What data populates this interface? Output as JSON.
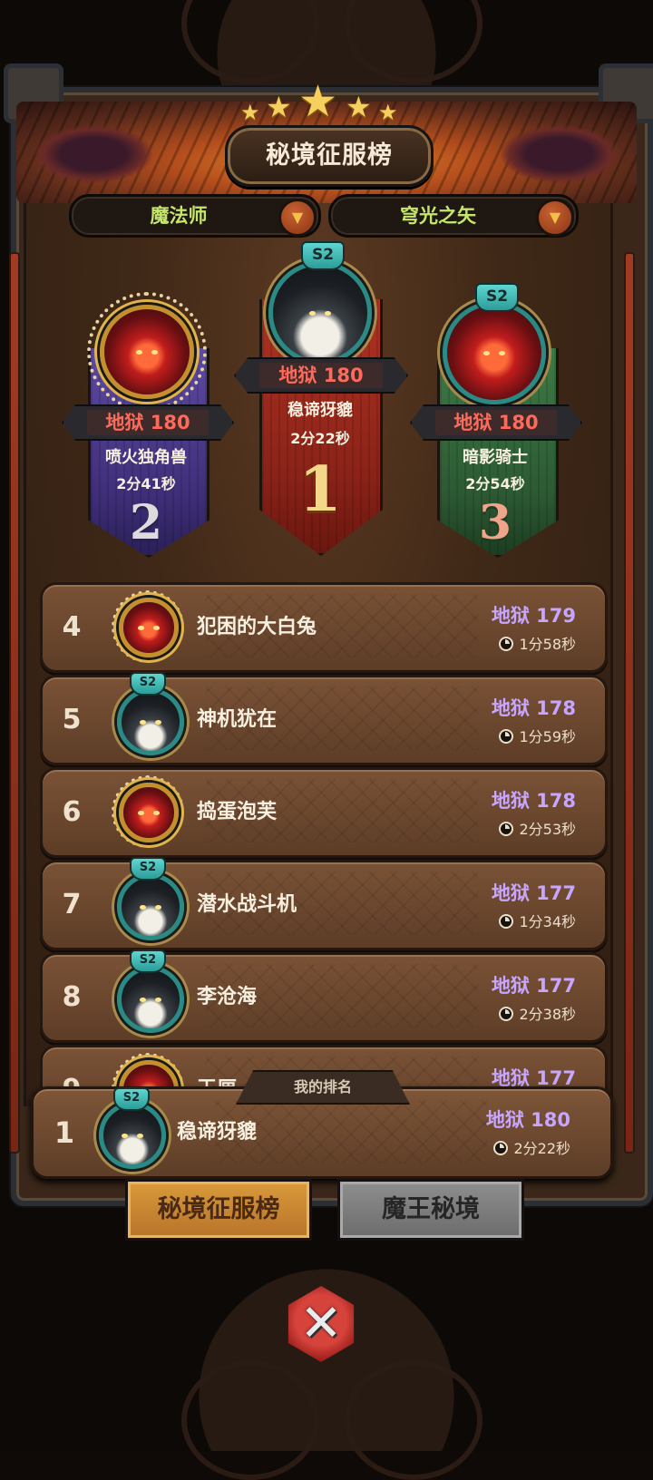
{
  "header": {
    "title": "秘境征服榜",
    "stars": 5
  },
  "filters": {
    "class_label": "魔法师",
    "skill_label": "穹光之矢"
  },
  "podium": [
    {
      "rank_label": "1",
      "level": "地狱 180",
      "name": "稳谛犽貔",
      "time": "2分22秒",
      "badge": "S2",
      "avatar": "dark-hood-avatar",
      "color": "#b03222"
    },
    {
      "rank_label": "2",
      "level": "地狱 180",
      "name": "喷火独角兽",
      "time": "2分41秒",
      "badge": "",
      "avatar": "red-demon-avatar",
      "color": "#5e4aa2"
    },
    {
      "rank_label": "3",
      "level": "地狱 180",
      "name": "暗影骑士",
      "time": "2分54秒",
      "badge": "S2",
      "avatar": "red-demon-avatar",
      "color": "#3e7a46"
    }
  ],
  "list": [
    {
      "rank": "4",
      "name": "犯困的大白兔",
      "level": "地狱 179",
      "time": "1分58秒",
      "badge": "",
      "avatar": "red"
    },
    {
      "rank": "5",
      "name": "神机犹在",
      "level": "地狱 178",
      "time": "1分59秒",
      "badge": "S2",
      "avatar": "dark"
    },
    {
      "rank": "6",
      "name": "捣蛋泡芙",
      "level": "地狱 178",
      "time": "2分53秒",
      "badge": "",
      "avatar": "red"
    },
    {
      "rank": "7",
      "name": "潜水战斗机",
      "level": "地狱 177",
      "time": "1分34秒",
      "badge": "S2",
      "avatar": "dark"
    },
    {
      "rank": "8",
      "name": "李沧海",
      "level": "地狱 177",
      "time": "2分38秒",
      "badge": "S2",
      "avatar": "dark"
    },
    {
      "rank": "9",
      "name": "王厘",
      "level": "地狱 177",
      "time": "",
      "badge": "",
      "avatar": "red"
    }
  ],
  "my_rank": {
    "tab_label": "我的排名",
    "rank": "1",
    "name": "稳谛犽貔",
    "level": "地狱 180",
    "time": "2分22秒",
    "badge": "S2"
  },
  "bottom_tabs": {
    "active": "秘境征服榜",
    "inactive": "魔王秘境"
  },
  "colors": {
    "level_purple": "#c7a6ff",
    "accent_red": "#ff6a5a",
    "filter_green": "#c6e66a"
  }
}
